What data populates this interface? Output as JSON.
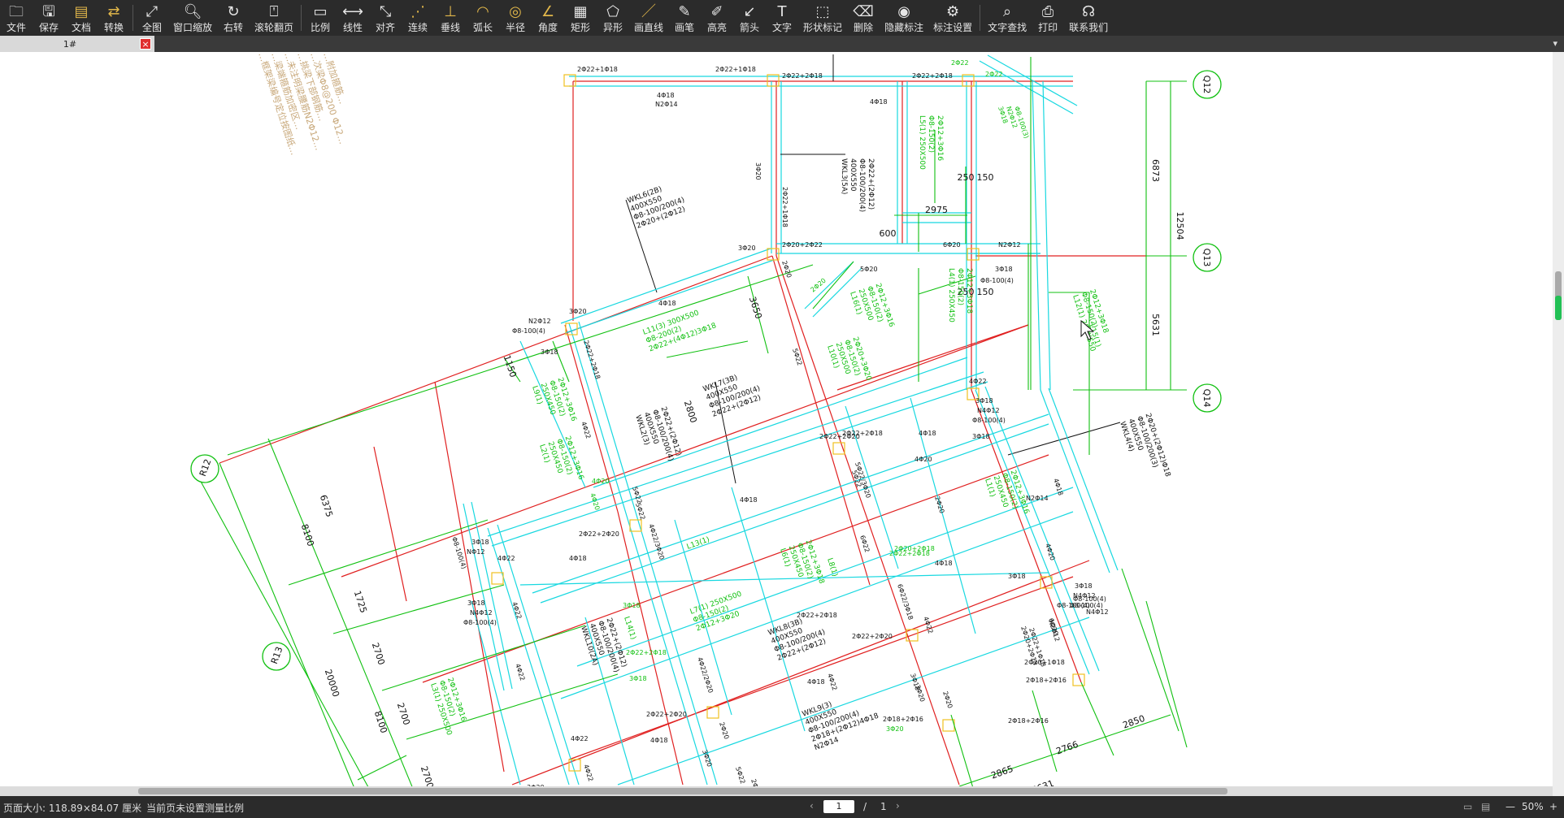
{
  "toolbar": {
    "file": {
      "label": "文件",
      "icon": "folder-icon"
    },
    "save": {
      "label": "保存",
      "icon": "save-icon"
    },
    "doc": {
      "label": "文档",
      "icon": "document-icon"
    },
    "convert": {
      "label": "转换",
      "icon": "convert-icon"
    },
    "fit": {
      "label": "全图",
      "icon": "fit-view-icon"
    },
    "zoom": {
      "label": "窗口缩放",
      "icon": "zoom-icon"
    },
    "rotate": {
      "label": "右转",
      "icon": "rotate-icon"
    },
    "wheel": {
      "label": "滚轮翻页",
      "icon": "mouse-wheel-icon"
    },
    "scale": {
      "label": "比例",
      "icon": "scale-icon"
    },
    "linear": {
      "label": "线性",
      "icon": "linear-dimension-icon"
    },
    "align": {
      "label": "对齐",
      "icon": "aligned-dimension-icon"
    },
    "continuous": {
      "label": "连续",
      "icon": "continuous-dimension-icon"
    },
    "perpendicular": {
      "label": "垂线",
      "icon": "perpendicular-icon"
    },
    "arc": {
      "label": "弧长",
      "icon": "arc-length-icon"
    },
    "radius": {
      "label": "半径",
      "icon": "radius-icon"
    },
    "angle": {
      "label": "角度",
      "icon": "angle-icon"
    },
    "rect": {
      "label": "矩形",
      "icon": "rectangle-area-icon"
    },
    "irregular": {
      "label": "异形",
      "icon": "irregular-area-icon"
    },
    "drawline": {
      "label": "画直线",
      "icon": "line-icon"
    },
    "pen": {
      "label": "画笔",
      "icon": "pen-icon"
    },
    "highlight": {
      "label": "高亮",
      "icon": "highlighter-icon"
    },
    "arrow": {
      "label": "箭头",
      "icon": "arrow-icon"
    },
    "text": {
      "label": "文字",
      "icon": "text-icon"
    },
    "shape": {
      "label": "形状标记",
      "icon": "shape-mark-icon"
    },
    "delete": {
      "label": "删除",
      "icon": "eraser-icon"
    },
    "hide": {
      "label": "隐藏标注",
      "icon": "eye-hidden-icon"
    },
    "settings": {
      "label": "标注设置",
      "icon": "mark-settings-icon"
    },
    "search": {
      "label": "文字查找",
      "icon": "search-icon"
    },
    "print": {
      "label": "打印",
      "icon": "print-icon"
    },
    "contact": {
      "label": "联系我们",
      "icon": "headset-icon"
    }
  },
  "tab": {
    "label": "1#",
    "close": "×",
    "menu": "▾"
  },
  "drawing": {
    "note_lines": [
      "…框架梁编号定位按图纸…",
      "…梁端箍筋加密区…",
      "…未注明梁腰筋N2Φ12…",
      "…挑梁下部钢筋…",
      "…次梁Φ8@200 Φ12…",
      "…附加箍筋…"
    ],
    "axes": {
      "q12": "Q12",
      "q13": "Q13",
      "q14": "Q14",
      "r12": "R12",
      "r13": "R13"
    },
    "dims": {
      "d6873": "6873",
      "d12504": "12504",
      "d5631": "5631",
      "d6375": "6375",
      "d8100a": "8100",
      "d1725": "1725",
      "d2700a": "2700",
      "d20000": "20000",
      "d8100b": "8100",
      "d2700b": "2700",
      "d2700c": "2700",
      "d2850": "2850",
      "d2766": "2766",
      "d2865": "2865",
      "d5631b": "5631",
      "d2975": "2975",
      "d600": "600",
      "d250a": "250",
      "d150a": "150",
      "d250b": "250",
      "d150b": "150",
      "d3650": "3650",
      "d1150": "1150",
      "d2800": "2800"
    },
    "beams": {
      "wkl6": [
        "WKL6(2B)",
        "400X550",
        "Φ8-100/200(4)",
        "2Φ20+(2Φ12)"
      ],
      "wkl3": [
        "WKL3(5A)",
        "400X550",
        "Φ8-100/200(4)",
        "2Φ22+(2Φ12)"
      ],
      "wkl7": [
        "WKL7(3B)",
        "400X550",
        "Φ8-100/200(4)",
        "2Φ22+(2Φ12)"
      ],
      "wkl2": [
        "WKL2(3)",
        "400X550",
        "Φ8-100/200(4)",
        "2Φ22+(2Φ12)"
      ],
      "wkl4": [
        "WKL4(4)",
        "400X550",
        "Φ8-100/200(3)",
        "2Φ20+(2Φ12)Φ18"
      ],
      "wkl10": [
        "WKL10(2A)",
        "400X550",
        "Φ8-100/200(4)",
        "2Φ22+(2Φ12)"
      ],
      "wkl8": [
        "WKL8(3B)",
        "400X550",
        "Φ8-100/200(4)",
        "2Φ22+(2Φ12)"
      ],
      "wkl9": [
        "WKL9(3)",
        "400X550",
        "Φ8-100/200(4)",
        "2Φ18+(2Φ12)4Φ18",
        "N2Φ14"
      ],
      "l11": [
        "L11(3) 300X500",
        "Φ8-200(2)",
        "2Φ22+(4Φ12)3Φ18"
      ],
      "l5": [
        "L5(1) 250X500",
        "Φ8-150(2)",
        "2Φ12+3Φ16"
      ],
      "l4": [
        "L4(1) 250X450",
        "Φ8-150(2)",
        "2Φ12+3Φ18"
      ],
      "l10": [
        "L10(1)",
        "250X500",
        "Φ8-150(2)",
        "2Φ20+3Φ20"
      ],
      "l16": [
        "L16(1)",
        "250X500",
        "Φ8-150(2)",
        "2Φ12+3Φ16"
      ],
      "l12": [
        "L12(1) 250X550",
        "Φ8-150(2)",
        "2Φ12+3Φ18"
      ],
      "l9": [
        "L9(1)",
        "250X450",
        "Φ8-150(2)",
        "2Φ12+3Φ16"
      ],
      "l2": [
        "L2(1)",
        "250X450",
        "Φ8-150(2)",
        "2Φ12+3Φ16"
      ],
      "l1": [
        "L1(1)",
        "250X450",
        "Φ8-150(2)",
        "2Φ12+3Φ16"
      ],
      "l6": [
        "L6(1)",
        "250X450",
        "Φ8-150(2)",
        "2Φ12+3Φ18"
      ],
      "l7": [
        "L7(1) 250X500",
        "Φ8-150(2)",
        "2Φ12+3Φ20"
      ],
      "l13": [
        "L13(1)"
      ],
      "l8": [
        "L8(1)"
      ],
      "l14": [
        "L14(1)"
      ],
      "l15": [
        "L15(1)"
      ],
      "l3": [
        "L3(1) 250X500",
        "Φ8-150(2)",
        "2Φ12+3Φ16"
      ]
    },
    "rebar": {
      "r1": "2Φ22+1Φ18",
      "r2": "2Φ22+1Φ18",
      "r3": "2Φ22+2Φ18",
      "r4": "2Φ22+2Φ18",
      "r5": "2Φ22",
      "r6": "2Φ22",
      "r7": "4Φ18",
      "r8": "N2Φ14",
      "r9": "4Φ18",
      "r10": "3Φ18",
      "r11": "N2Φ12",
      "r12": "Φ8-100(3)",
      "r13": "3Φ20",
      "r14": "2Φ22+1Φ18",
      "r15": "2Φ20+2Φ22",
      "r16": "6Φ20",
      "r17": "N2Φ12",
      "r18": "3Φ18",
      "r19": "Φ8-100(4)",
      "r20": "5Φ20",
      "r21": "3Φ20",
      "r22": "2Φ20",
      "r23": "4Φ18",
      "r24": "3Φ20",
      "r25": "N2Φ12",
      "r26": "Φ8-100(4)",
      "r27": "3Φ18",
      "r28": "2Φ22+2Φ18",
      "r29": "2Φ20",
      "r30": "5Φ22",
      "r31": "4Φ22",
      "r32": "4Φ20",
      "r33": "3Φ18",
      "r34": "NΦ12",
      "r35": "Φ8-100(4)",
      "r36": "5Φ22",
      "r37": "2Φ22+2Φ20",
      "r38": "3Φ18",
      "r39": "N4Φ12",
      "r40": "Φ8-100(4)",
      "r41": "2Φ22+2Φ18",
      "r42": "4Φ18",
      "r43": "5Φ22",
      "r44": "4Φ18",
      "r45": "2Φ22+2Φ20",
      "r46": "3Φ18",
      "r47": "N4Φ12",
      "r48": "Φ8-100(4)",
      "r49": "4Φ22",
      "r50": "4Φ20",
      "r51": "3Φ18",
      "r52": "Φ8-100(4)",
      "r53": "4Φ18",
      "r54": "2Φ22+2Φ18",
      "r55": "5Φ22",
      "r56": "6Φ22",
      "r57": "4Φ20",
      "r58": "4Φ18",
      "r59": "2Φ22+2Φ18",
      "r60": "3Φ18",
      "r61": "N4Φ12",
      "r62": "Φ8-100(4)",
      "r63": "2Φ20+2Φ18",
      "r64": "4Φ18",
      "r65": "3Φ18",
      "r66": "2Φ20",
      "r67": "6Φ20",
      "r68": "4Φ18",
      "r69": "3Φ20",
      "r70": "5Φ22",
      "r71": "4Φ22",
      "r72": "2Φ22+2Φ20",
      "r73": "4Φ18",
      "r74": "2Φ20",
      "r75": "3Φ20",
      "r76": "N2Φ14",
      "r77": "2Φ22+1Φ18",
      "r78": "2Φ18+2Φ16",
      "r79": "3Φ20",
      "r80": "4Φ22",
      "r81": "3Φ20",
      "r82": "4Φ22",
      "r83": "5Φ22/3Φ20",
      "r84": "4Φ22/3Φ20",
      "r85": "4Φ22/2Φ20",
      "r86": "6Φ22/3Φ18",
      "r87": "4Φ22",
      "r88": "2Φ20",
      "r89": "2Φ18+2Φ16",
      "r90": "3Φ18",
      "r91": "2Φ22+2Φ18",
      "r92": "4Φ22",
      "r93": "4Φ20",
      "r94": "3Φ18",
      "r95": "N2Φ12",
      "r96": "2Φ22+2Φ20",
      "r97": "2Φ20+1Φ18",
      "r98": "4Φ22",
      "r99": "2Φ20+2Φ18",
      "r100": "2Φ20",
      "r101": "3Φ18",
      "r102": "Φ8-100(4)",
      "r103": "2Φ18+2Φ16",
      "r104": "4Φ22",
      "r105": "N4Φ12"
    }
  },
  "status": {
    "page_size": "页面大小: 118.89×84.07 厘米",
    "scale_note": "当前页未设置测量比例",
    "page_current": "1",
    "page_sep": "/",
    "page_total": "1",
    "zoom": "50%",
    "prev": "‹",
    "next": "›",
    "zoom_minus": "—",
    "zoom_plus": "+"
  },
  "colors": {
    "toolbar_bg": "#2b2b2b",
    "red": "#e02020",
    "cyan": "#18d8e0",
    "green": "#10c010",
    "black": "#111111",
    "note": "#c8a87a"
  }
}
